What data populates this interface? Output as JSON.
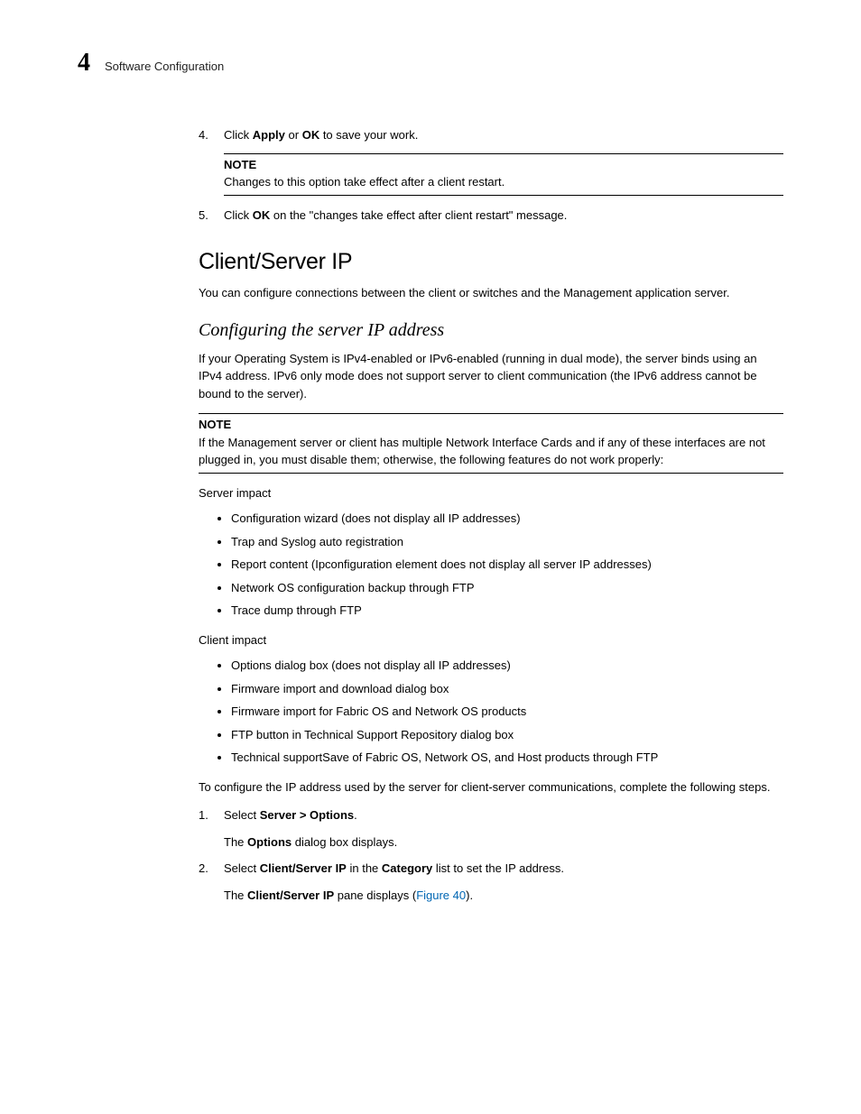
{
  "header": {
    "chapter_number": "4",
    "chapter_title": "Software Configuration"
  },
  "step4": {
    "num": "4.",
    "before": "Click ",
    "apply": "Apply",
    "mid": " or ",
    "ok": "OK",
    "after": " to save your work."
  },
  "note1": {
    "label": "NOTE",
    "text": "Changes to this option take effect after a client restart."
  },
  "step5": {
    "num": "5.",
    "before": "Click ",
    "ok": "OK",
    "after": " on the \"changes take effect after client restart\" message."
  },
  "section": {
    "title": "Client/Server IP",
    "intro": "You can configure connections between the client or switches and the Management application server."
  },
  "subsection": {
    "title": "Configuring the server IP address",
    "intro": "If your Operating System is IPv4-enabled or IPv6-enabled (running in dual mode), the server binds using an IPv4 address. IPv6 only mode does not support server to client communication (the IPv6 address cannot be bound to the server)."
  },
  "note2": {
    "label": "NOTE",
    "text": "If the Management server or client has multiple Network Interface Cards and if any of these interfaces are not plugged in, you must disable them; otherwise, the following features do not work properly:"
  },
  "server_impact": {
    "label": "Server impact",
    "items": [
      "Configuration wizard (does not display all IP addresses)",
      "Trap and Syslog auto registration",
      "Report content (Ipconfiguration element does not display all server IP addresses)",
      "Network OS configuration backup through FTP",
      "Trace dump through FTP"
    ]
  },
  "client_impact": {
    "label": "Client impact",
    "items": [
      "Options dialog box (does not display all IP addresses)",
      "Firmware import and download dialog box",
      "Firmware import for Fabric OS and Network OS products",
      "FTP button in Technical Support Repository dialog box",
      "Technical supportSave of Fabric OS, Network OS, and Host products through FTP"
    ]
  },
  "config_intro": "To configure the IP address used by the server for client-server communications, complete the following steps.",
  "cfg_step1": {
    "num": "1.",
    "before": "Select ",
    "bold": "Server > Options",
    "after": ".",
    "sub_before": "The ",
    "sub_bold": "Options",
    "sub_after": " dialog box displays."
  },
  "cfg_step2": {
    "num": "2.",
    "t1": "Select ",
    "b1": "Client/Server IP",
    "t2": " in the ",
    "b2": "Category",
    "t3": " list to set the IP address.",
    "sub_before": "The ",
    "sub_bold": "Client/Server IP",
    "sub_mid": " pane displays (",
    "sub_link": "Figure 40",
    "sub_after": ")."
  }
}
